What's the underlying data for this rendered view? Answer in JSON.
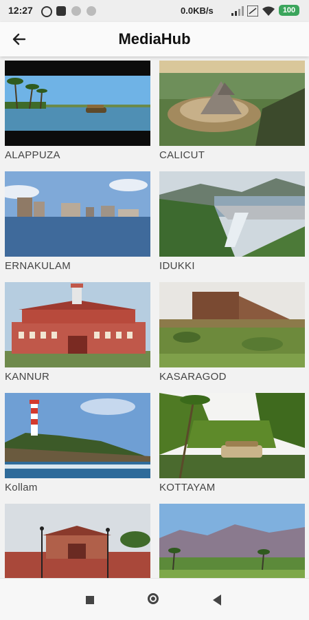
{
  "status_bar": {
    "time": "12:27",
    "network_speed": "0.0KB/s",
    "battery": "100"
  },
  "app_bar": {
    "title": "MediaHub",
    "back_icon": "arrow-left-icon"
  },
  "destinations": [
    {
      "name": "ALAPPUZA",
      "scene": "backwaters-houseboat"
    },
    {
      "name": "CALICUT",
      "scene": "bird-sculpture-hill"
    },
    {
      "name": "ERNAKULAM",
      "scene": "city-skyline-water"
    },
    {
      "name": "IDUKKI",
      "scene": "dam-hills"
    },
    {
      "name": "KANNUR",
      "scene": "red-heritage-building"
    },
    {
      "name": "KASARAGOD",
      "scene": "fort-field"
    },
    {
      "name": "Kollam",
      "scene": "lighthouse-coast"
    },
    {
      "name": "KOTTAYAM",
      "scene": "palms-houseboat"
    },
    {
      "name": "",
      "scene": "red-building-road"
    },
    {
      "name": "",
      "scene": "mountains-fields"
    }
  ],
  "nav_bar": {
    "recents_icon": "square-icon",
    "home_icon": "circle-icon",
    "back_icon": "triangle-back-icon"
  },
  "colors": {
    "accent_battery": "#3ba55c",
    "background": "#f2f2f2"
  }
}
